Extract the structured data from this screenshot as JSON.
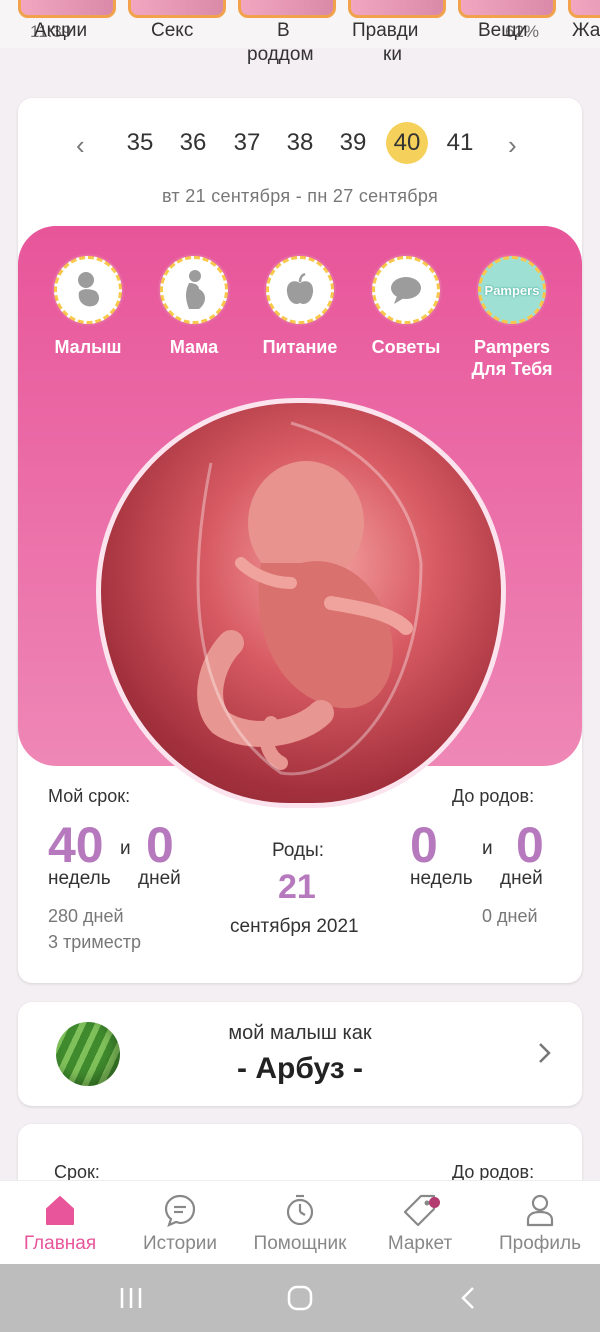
{
  "stories": [
    {
      "label": "Акции"
    },
    {
      "label": "Секс"
    },
    {
      "label": "В",
      "sub": "роддом"
    },
    {
      "label": "Правди",
      "sub": "ки"
    },
    {
      "label": "Вещи"
    },
    {
      "label": "Жа"
    }
  ],
  "status_bar": {
    "time": "11:39",
    "battery": "62%"
  },
  "weeks": {
    "prev_arrow": "‹",
    "next_arrow": "›",
    "items": [
      "35",
      "36",
      "37",
      "38",
      "39",
      "40",
      "41"
    ],
    "active": "40",
    "date_range": "вт 21 сентября - пн 27 сентября"
  },
  "categories": [
    {
      "label": "Малыш",
      "icon": "baby-icon"
    },
    {
      "label": "Мама",
      "icon": "pregnant-woman-icon"
    },
    {
      "label": "Питание",
      "icon": "apple-icon"
    },
    {
      "label": "Советы",
      "icon": "chat-bubble-icon"
    },
    {
      "label": "Pampers\nДля Тебя",
      "icon": "pampers-logo",
      "logo_text": "Pampers"
    }
  ],
  "term": {
    "my_term_label": "Мой срок:",
    "weeks_value": "40",
    "and": "и",
    "days_value": "0",
    "weeks_unit": "недель",
    "days_unit": "дней",
    "total_days": "280 дней",
    "trimester": "3 триместр"
  },
  "birth": {
    "label": "Роды:",
    "day": "21",
    "month_year": "сентября 2021"
  },
  "until_birth": {
    "label": "До родов:",
    "weeks_value": "0",
    "and": "и",
    "days_value": "0",
    "weeks_unit": "недель",
    "days_unit": "дней",
    "remaining_days": "0 дней"
  },
  "baby_size": {
    "label": "мой малыш как",
    "fruit": "- Арбуз -"
  },
  "card3": {
    "term_label": "Срок:",
    "until_label": "До родов:"
  },
  "bottom_nav": [
    {
      "label": "Главная",
      "icon": "home-icon"
    },
    {
      "label": "Истории",
      "icon": "chat-icon"
    },
    {
      "label": "Помощник",
      "icon": "stopwatch-icon"
    },
    {
      "label": "Маркет",
      "icon": "tag-icon"
    },
    {
      "label": "Профиль",
      "icon": "profile-icon"
    }
  ],
  "colors": {
    "accent_pink": "#e8559a",
    "highlight_yellow": "#f5d15b",
    "value_purple": "#b779bd"
  }
}
